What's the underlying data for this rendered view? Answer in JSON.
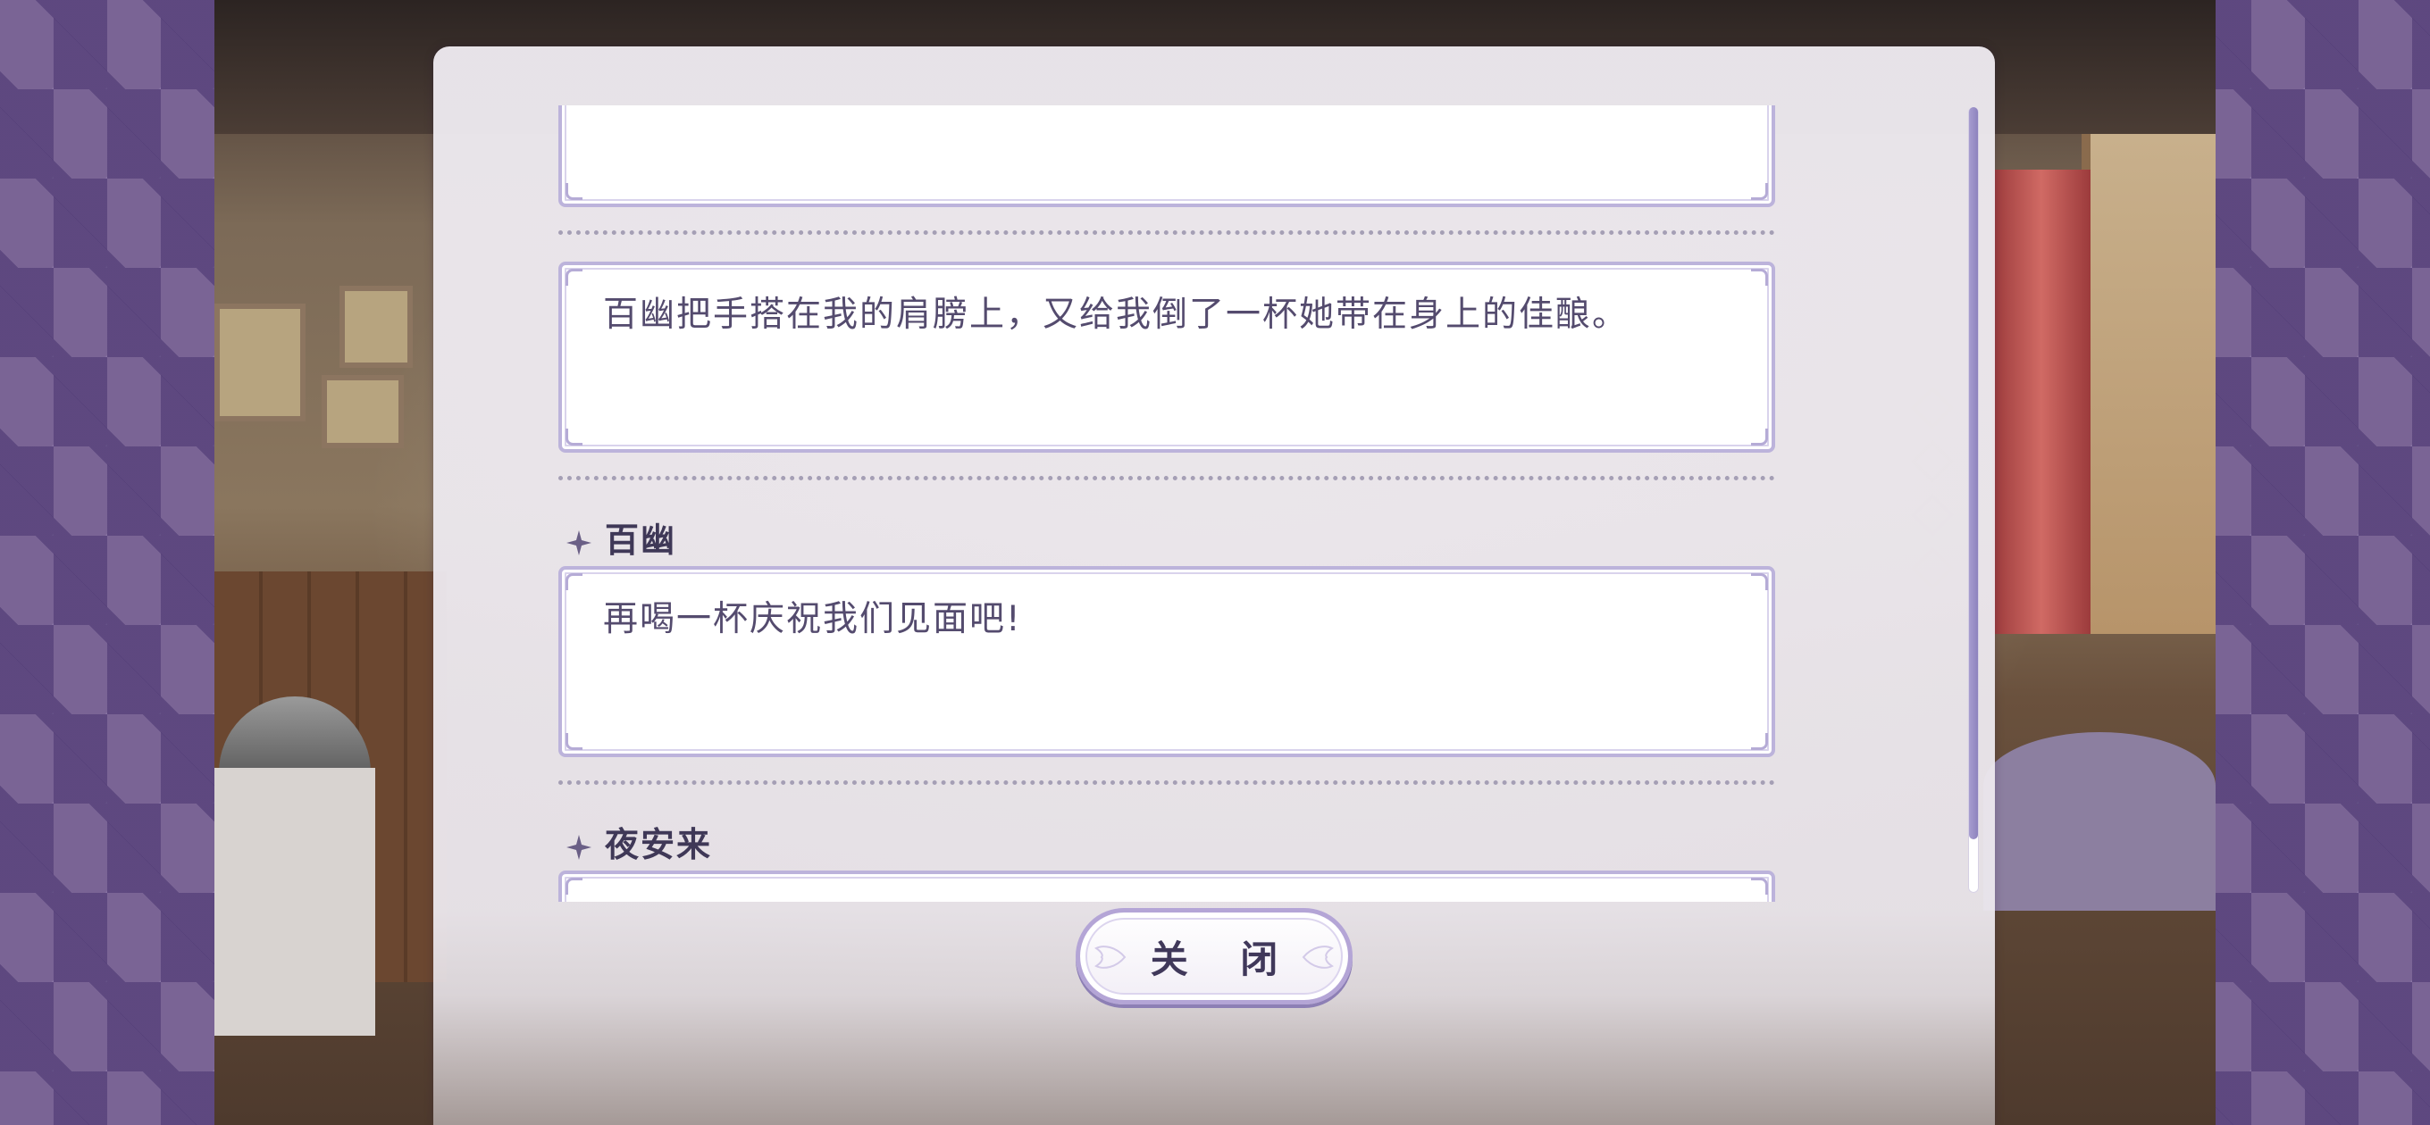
{
  "log": {
    "entries": [
      {
        "speaker": "",
        "text": ""
      },
      {
        "speaker": "",
        "text": "百幽把手搭在我的肩膀上，又给我倒了一杯她带在身上的佳酿。"
      },
      {
        "speaker": "百幽",
        "text": "再喝一杯庆祝我们见面吧!"
      },
      {
        "speaker": "夜安来",
        "text": ""
      }
    ]
  },
  "controls": {
    "close_label": "关 闭"
  },
  "colors": {
    "accent": "#b4a5d6",
    "text": "#544b6e",
    "name": "#3f3857",
    "scrollbar": "#8d82bd"
  },
  "icons": {
    "speaker_marker": "four-point-star-icon"
  }
}
